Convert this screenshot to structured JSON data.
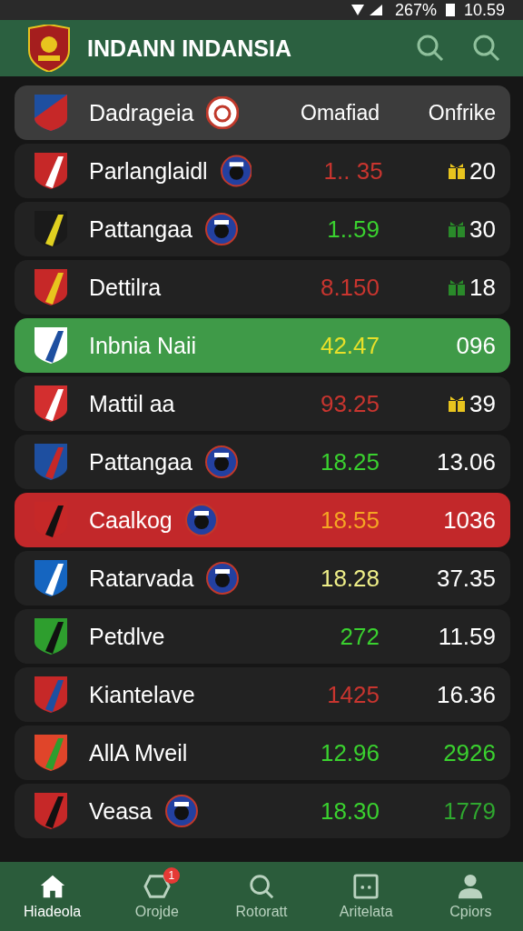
{
  "status_bar": {
    "battery": "267%",
    "time": "10.59"
  },
  "app_bar": {
    "title": "INDANN INDANSIA"
  },
  "table": {
    "header": {
      "name": "Dadrageia",
      "column_2": "Omafiad",
      "column_3": "Onfrike"
    },
    "rows": [
      {
        "name": "Parlanglaidl",
        "badge": true,
        "value": {
          "text": "1.. 35",
          "color": "#c8352f"
        },
        "count": {
          "text": "20",
          "color": "#ffffff"
        },
        "trophy": {
          "color": "#e8c41e"
        }
      },
      {
        "name": "Pattangaa",
        "badge": true,
        "value": {
          "text": "1..59",
          "color": "#3ad12f"
        },
        "count": {
          "text": "30",
          "color": "#ffffff"
        },
        "trophy": {
          "color": "#2a8a2a"
        }
      },
      {
        "name": "Dettilra",
        "badge": false,
        "value": {
          "text": "8.150",
          "color": "#c8352f"
        },
        "count": {
          "text": "18",
          "color": "#ffffff"
        },
        "trophy": {
          "color": "#2a8a2a"
        }
      },
      {
        "name": "Inbnia Naii",
        "badge": false,
        "color": "#3f9a48",
        "value": {
          "text": "42.47",
          "color": "#e8e02a"
        },
        "count": {
          "text": "096",
          "color": "#ffffff"
        }
      },
      {
        "name": "Mattil aa",
        "badge": false,
        "value": {
          "text": "93.25",
          "color": "#c8352f"
        },
        "count": {
          "text": "39",
          "color": "#ffffff"
        },
        "trophy": {
          "color": "#e8c41e"
        }
      },
      {
        "name": "Pattangaa",
        "badge": true,
        "value": {
          "text": "18.25",
          "color": "#3ad12f"
        },
        "count": {
          "text": "13.06",
          "color": "#ffffff"
        }
      },
      {
        "name": "Caalkog",
        "badge": true,
        "color": "#c2282a",
        "value": {
          "text": "18.55",
          "color": "#f5a623"
        },
        "count": {
          "text": "1036",
          "color": "#ffffff"
        }
      },
      {
        "name": "Ratarvada",
        "badge": true,
        "value": {
          "text": "18.28",
          "color": "#eeee88"
        },
        "count": {
          "text": "37.35",
          "color": "#ffffff"
        }
      },
      {
        "name": "Petdlve",
        "badge": false,
        "value": {
          "text": "272",
          "color": "#3ad12f"
        },
        "count": {
          "text": "11.59",
          "color": "#ffffff"
        }
      },
      {
        "name": "Kiantelave",
        "badge": false,
        "value": {
          "text": "1425",
          "color": "#c8352f"
        },
        "count": {
          "text": "16.36",
          "color": "#ffffff"
        }
      },
      {
        "name": "AllA Mveil",
        "badge": false,
        "value": {
          "text": "12.96",
          "color": "#3ad12f"
        },
        "count": {
          "text": "2926",
          "color": "#3ad12f"
        }
      },
      {
        "name": "Veasa",
        "badge": true,
        "value": {
          "text": "18.30",
          "color": "#3ad12f"
        },
        "count": {
          "text": "1779",
          "color": "#2fa82f"
        }
      }
    ]
  },
  "bottom_nav": [
    {
      "kind": "home",
      "label": "Hiadeola",
      "selected": true
    },
    {
      "kind": "shape",
      "label": "Orojde",
      "selected": false,
      "badge": "1"
    },
    {
      "kind": "search",
      "label": "Rotoratt",
      "selected": false
    },
    {
      "kind": "box",
      "label": "Aritelata",
      "selected": false
    },
    {
      "kind": "person",
      "label": "Cpiors",
      "selected": false
    }
  ]
}
